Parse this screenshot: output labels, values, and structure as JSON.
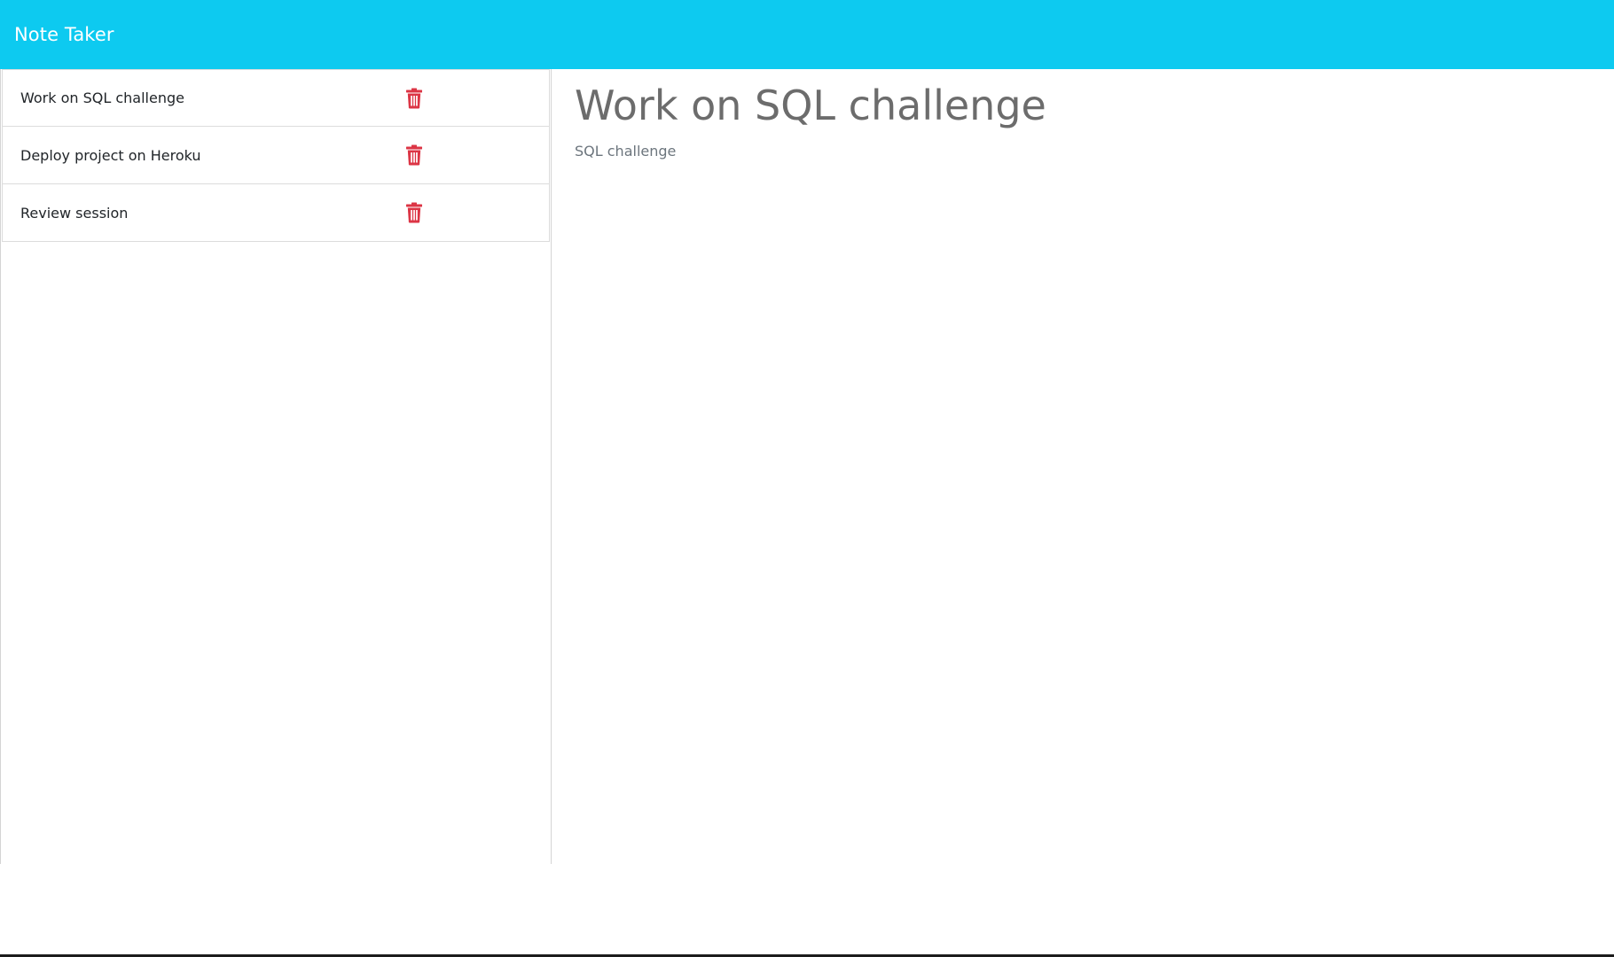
{
  "colors": {
    "navbar_bg": "#0dcaf0",
    "delete_icon": "#dc3545"
  },
  "navbar": {
    "brand": "Note Taker"
  },
  "notes": [
    {
      "title": "Work on SQL challenge",
      "delete_icon": "trash-icon"
    },
    {
      "title": "Deploy project on Heroku",
      "delete_icon": "trash-icon"
    },
    {
      "title": "Review session",
      "delete_icon": "trash-icon"
    }
  ],
  "active_note": {
    "title": "Work on SQL challenge",
    "text": "SQL challenge"
  }
}
